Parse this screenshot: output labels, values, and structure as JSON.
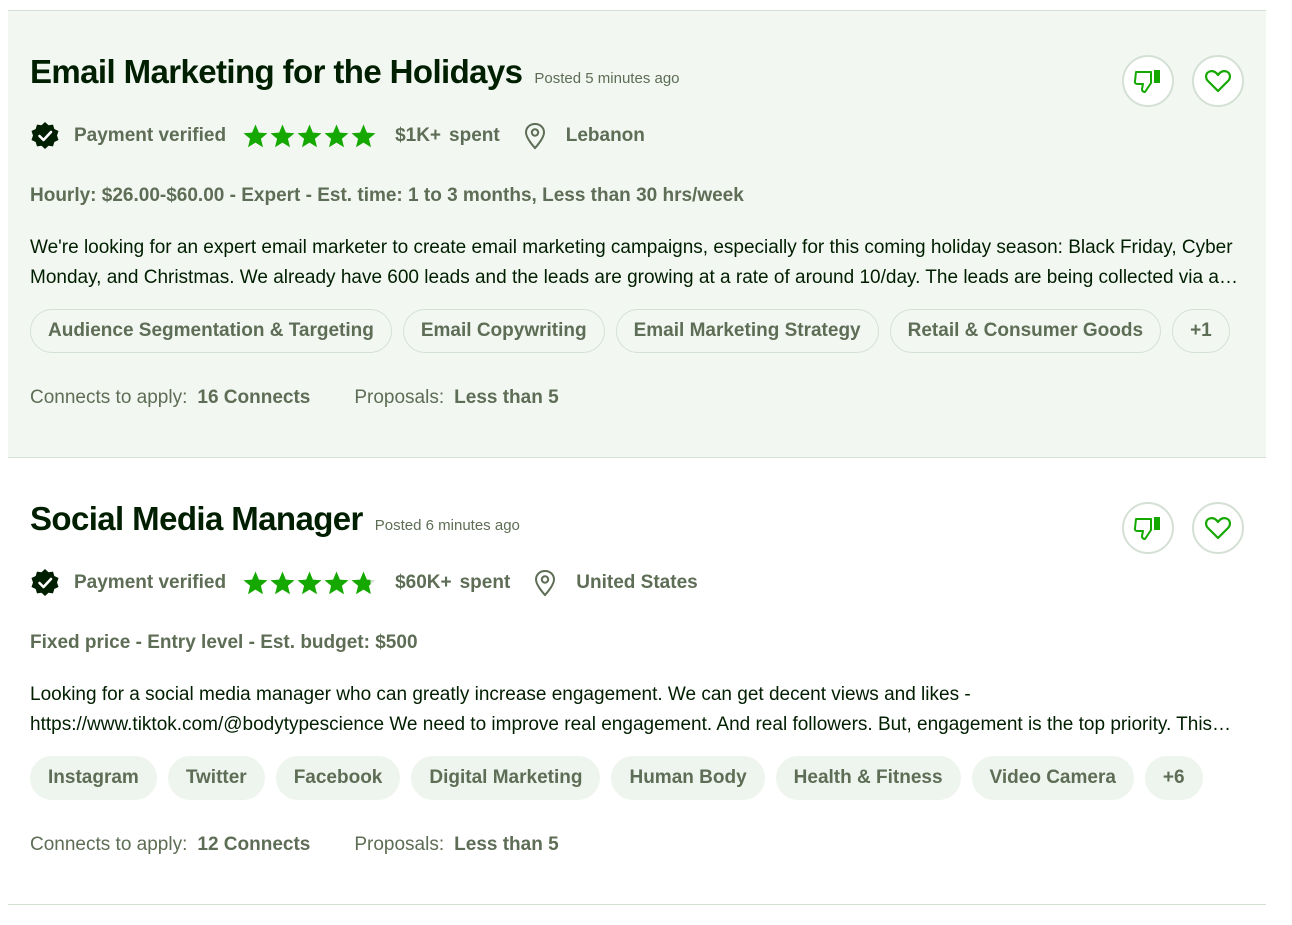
{
  "colors": {
    "brand_green": "#14a800",
    "heading": "#001e00",
    "muted": "#5e6d55",
    "hover_background": "#f2f7f2",
    "border": "#d5e0d5"
  },
  "jobs": [
    {
      "title": "Email Marketing for the Holidays",
      "posted": "Posted 5 minutes ago",
      "payment": "Payment verified",
      "rating_stars": 5,
      "spent_amount": "$1K+",
      "spent_label": "spent",
      "location": "Lebanon",
      "terms": "Hourly: $26.00-$60.00 - Expert - Est. time: 1 to 3 months, Less than 30 hrs/week",
      "description": "We're looking for an expert email marketer to create email marketing campaigns, especially for this coming holiday season: Black Friday, Cyber Monday, and Christmas. We already have 600 leads and the leads are growing at a rate of around 10/day. The leads are being collected via a F…",
      "skills": [
        "Audience Segmentation & Targeting",
        "Email Copywriting",
        "Email Marketing Strategy",
        "Retail & Consumer Goods",
        "+1"
      ],
      "connects_label": "Connects to apply:",
      "connects_value": "16 Connects",
      "proposals_label": "Proposals:",
      "proposals_value": "Less than 5",
      "icons": {
        "dislike": "thumbs-down-icon",
        "save": "heart-icon",
        "verified": "verified-badge-icon",
        "location": "location-pin-icon"
      }
    },
    {
      "title": "Social Media Manager",
      "posted": "Posted 6 minutes ago",
      "payment": "Payment verified",
      "rating_stars": 4.8,
      "spent_amount": "$60K+",
      "spent_label": "spent",
      "location": "United States",
      "terms": "Fixed price - Entry level - Est. budget: $500",
      "description": "Looking for a social media manager who can greatly increase engagement. We can get decent views and likes - https://www.tiktok.com/@bodytypescience We need to improve real engagement. And real followers. But, engagement is the top priority. This…",
      "skills": [
        "Instagram",
        "Twitter",
        "Facebook",
        "Digital Marketing",
        "Human Body",
        "Health & Fitness",
        "Video Camera",
        "+6"
      ],
      "connects_label": "Connects to apply:",
      "connects_value": "12 Connects",
      "proposals_label": "Proposals:",
      "proposals_value": "Less than 5",
      "icons": {
        "dislike": "thumbs-down-icon",
        "save": "heart-icon",
        "verified": "verified-badge-icon",
        "location": "location-pin-icon"
      }
    }
  ]
}
